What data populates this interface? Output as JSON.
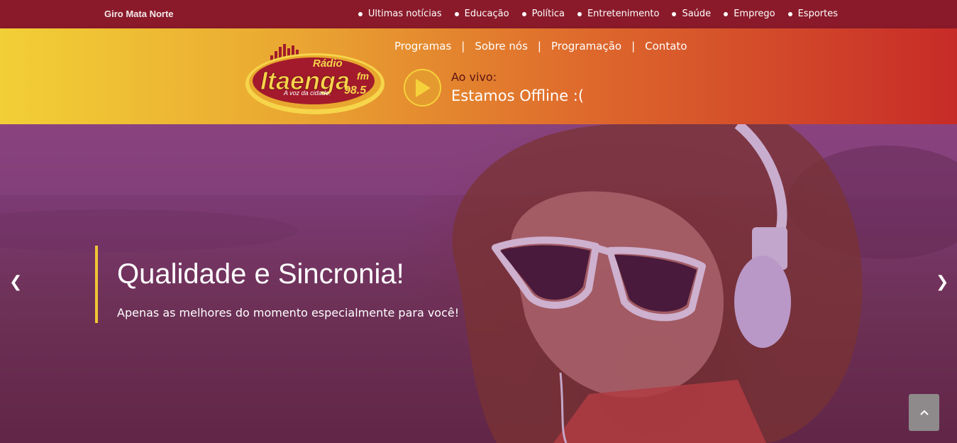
{
  "site": {
    "name": "Giro Mata Norte"
  },
  "topnav": [
    {
      "label": "Ultimas notícias"
    },
    {
      "label": "Educação"
    },
    {
      "label": "Política"
    },
    {
      "label": "Entretenimento"
    },
    {
      "label": "Saúde"
    },
    {
      "label": "Emprego"
    },
    {
      "label": "Esportes"
    }
  ],
  "logo": {
    "top": "Rádio",
    "name": "Itaenga",
    "fm": "fm",
    "freq": "98.5",
    "slogan": "A voz da cidade."
  },
  "mainnav": [
    {
      "label": "Programas"
    },
    {
      "label": "Sobre nós"
    },
    {
      "label": "Programação"
    },
    {
      "label": "Contato"
    }
  ],
  "player": {
    "live_label": "Ao vivo:",
    "status": "Estamos Offline :(",
    "icon": "play-icon"
  },
  "hero": {
    "title": "Qualidade e Sincronia!",
    "subtitle": "Apenas as melhores do momento especialmente para você!",
    "prev": "❮",
    "next": "❯"
  },
  "colors": {
    "topbar": "#8a1a2a",
    "accent": "#f0c536",
    "brand_red": "#a01b2b"
  }
}
